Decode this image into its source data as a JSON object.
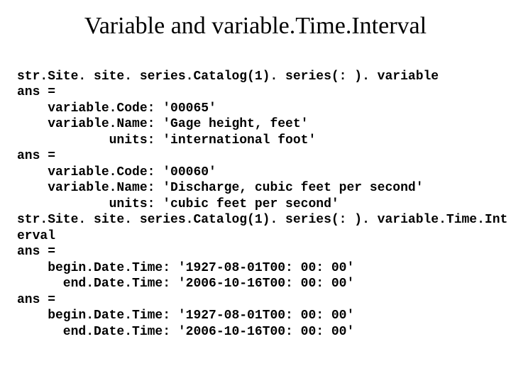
{
  "title": "Variable and variable.Time.Interval",
  "lines": {
    "l1": "str.Site. site. series.Catalog(1). series(: ). variable",
    "l2": "ans =",
    "l3": "    variable.Code: '00065'",
    "l4": "    variable.Name: 'Gage height, feet'",
    "l5": "            units: 'international foot'",
    "l6": "ans =",
    "l7": "    variable.Code: '00060'",
    "l8": "    variable.Name: 'Discharge, cubic feet per second'",
    "l9": "            units: 'cubic feet per second'",
    "l10": "str.Site. site. series.Catalog(1). series(: ). variable.Time.Int",
    "l11": "erval",
    "l12": "ans =",
    "l13": "    begin.Date.Time: '1927-08-01T00: 00: 00'",
    "l14": "      end.Date.Time: '2006-10-16T00: 00: 00'",
    "l15": "ans =",
    "l16": "    begin.Date.Time: '1927-08-01T00: 00: 00'",
    "l17": "      end.Date.Time: '2006-10-16T00: 00: 00'"
  }
}
